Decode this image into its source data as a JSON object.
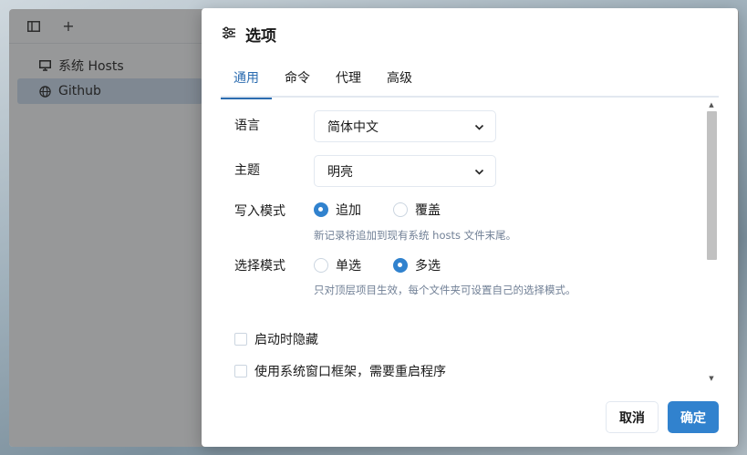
{
  "app": {
    "toolbar": {
      "toggle_sidebar_icon": "sidebar-panel-icon",
      "add_icon": "plus-icon",
      "add_glyph": "+"
    },
    "sidebar": {
      "items": [
        {
          "label": "系统 Hosts",
          "icon": "monitor-icon",
          "active": false
        },
        {
          "label": "Github",
          "icon": "globe-icon",
          "active": true
        }
      ]
    }
  },
  "dialog": {
    "title": "选项",
    "title_icon": "sliders-icon",
    "tabs": [
      {
        "label": "通用",
        "active": true
      },
      {
        "label": "命令",
        "active": false
      },
      {
        "label": "代理",
        "active": false
      },
      {
        "label": "高级",
        "active": false
      }
    ],
    "general": {
      "language": {
        "label": "语言",
        "value": "简体中文"
      },
      "theme": {
        "label": "主题",
        "value": "明亮"
      },
      "write_mode": {
        "label": "写入模式",
        "options": [
          {
            "label": "追加",
            "checked": true
          },
          {
            "label": "覆盖",
            "checked": false
          }
        ],
        "hint": "新记录将追加到现有系统 hosts 文件末尾。"
      },
      "choice_mode": {
        "label": "选择模式",
        "options": [
          {
            "label": "单选",
            "checked": false
          },
          {
            "label": "多选",
            "checked": true
          }
        ],
        "hint": "只对顶层项目生效，每个文件夹可设置自己的选择模式。"
      },
      "hide_at_launch": {
        "label": "启动时隐藏",
        "checked": false
      },
      "use_system_frame": {
        "label": "使用系统窗口框架，需要重启程序",
        "checked": false
      }
    },
    "buttons": {
      "cancel": "取消",
      "ok": "确定"
    }
  },
  "colors": {
    "accent": "#3182ce",
    "active_tab": "#2b6cb0",
    "hint": "#718096",
    "sidebar_active": "#c7d8ea"
  }
}
